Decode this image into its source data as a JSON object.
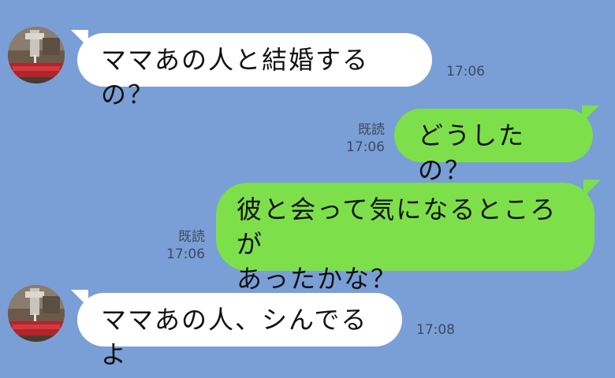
{
  "colors": {
    "background": "#7a9fd6",
    "incoming_bubble": "#ffffff",
    "outgoing_bubble": "#7ddf4a",
    "meta_text": "#3d4a5e"
  },
  "messages": [
    {
      "direction": "incoming",
      "avatar_icon": "sewing-machine-avatar",
      "text": "ママあの人と結婚するの？",
      "time": "17:06"
    },
    {
      "direction": "outgoing",
      "read": "既読",
      "text": "どうしたの？",
      "time": "17:06"
    },
    {
      "direction": "outgoing",
      "read": "既読",
      "text": "彼と会って気になるところが\nあったかな？",
      "time": "17:06"
    },
    {
      "direction": "incoming",
      "avatar_icon": "sewing-machine-avatar",
      "text": "ママあの人、シんでるよ",
      "time": "17:08"
    }
  ]
}
